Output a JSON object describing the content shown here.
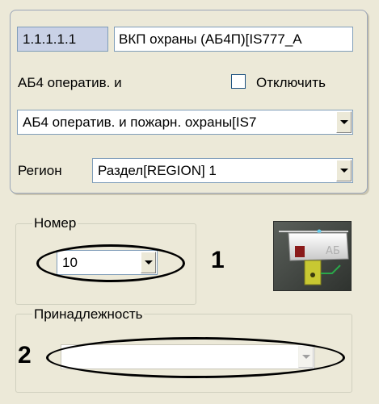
{
  "device": {
    "id": "1.1.1.1.1",
    "name": "ВКП охраны (АБ4П)[IS777_A",
    "type_label": "АБ4 оператив. и",
    "disable_label": "Отключить",
    "disable_checked": false,
    "type_value": "АБ4 оператив. и пожарн. охраны[IS7",
    "region_label": "Регион",
    "region_value": "Раздел[REGION] 1",
    "image_caption": "АБ"
  },
  "number_group": {
    "label": "Номер",
    "value": "10",
    "marker": "1"
  },
  "belong_group": {
    "label": "Принадлежность",
    "value": "",
    "marker": "2"
  },
  "icons": {
    "dropdown": "chevron-down-icon",
    "device": "device-module-icon"
  }
}
